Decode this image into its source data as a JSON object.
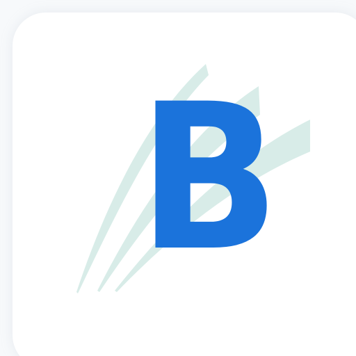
{
  "logo": {
    "letter": "B",
    "letter_color": "#1b73db",
    "swoosh_color": "#d8ece8",
    "tile_color": "#ffffff",
    "background_color": "#f7f9fb",
    "icon_name": "app-logo-icon"
  }
}
